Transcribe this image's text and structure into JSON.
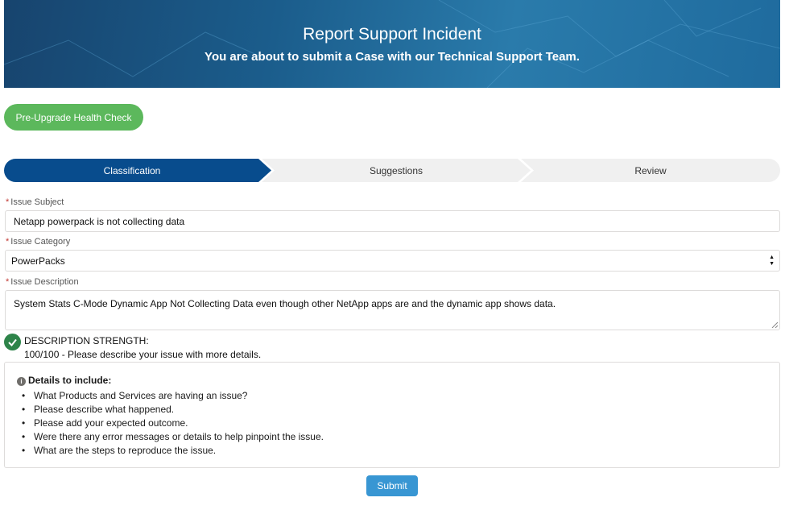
{
  "banner": {
    "title": "Report Support Incident",
    "subtitle": "You are about to submit a Case with our Technical Support Team."
  },
  "health_check_label": "Pre-Upgrade Health Check",
  "steps": [
    {
      "label": "Classification",
      "active": true
    },
    {
      "label": "Suggestions",
      "active": false
    },
    {
      "label": "Review",
      "active": false
    }
  ],
  "form": {
    "required_mark": "*",
    "subject_label": "Issue Subject",
    "subject_value": "Netapp powerpack is not collecting data",
    "category_label": "Issue Category",
    "category_value": "PowerPacks",
    "description_label": "Issue Description",
    "description_value": "System Stats C-Mode Dynamic App Not Collecting Data even though other NetApp apps are and the dynamic app shows data."
  },
  "strength": {
    "icon": "check-circle-icon",
    "title": "DESCRIPTION STRENGTH:",
    "score_text": "100/100 - Please describe your issue with more details."
  },
  "details": {
    "icon": "info-icon",
    "title": "Details to include:",
    "items": [
      "What Products and Services are having an issue?",
      "Please describe what happened.",
      "Please add your expected outcome.",
      "Were there any error messages or details to help pinpoint the issue.",
      "What are the steps to reproduce the issue."
    ]
  },
  "submit_label": "Submit",
  "colors": {
    "step_active": "#084c8d",
    "health_green": "#5cb85c",
    "submit_blue": "#3896d3",
    "check_green": "#2e844a"
  }
}
